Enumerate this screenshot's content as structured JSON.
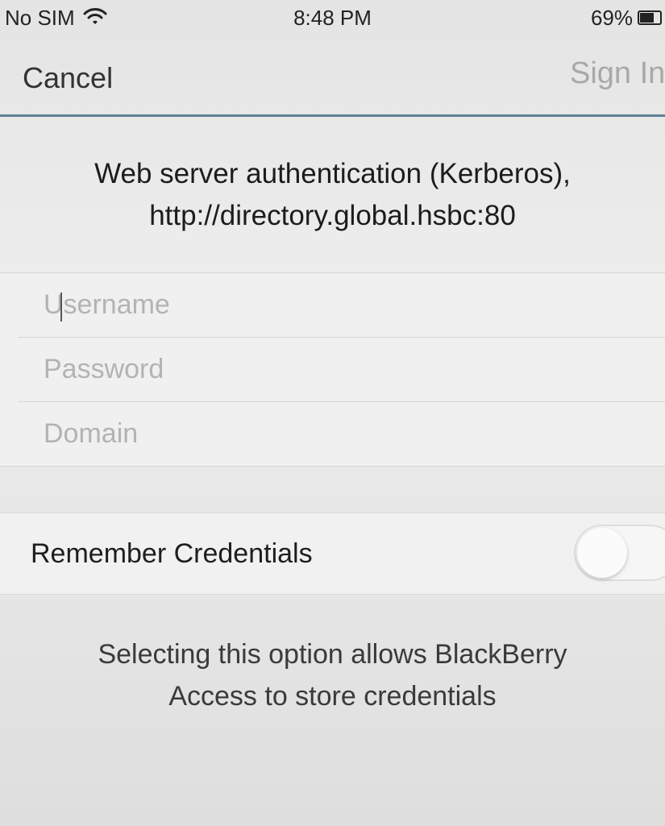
{
  "status_bar": {
    "carrier": "No SIM",
    "time": "8:48 PM",
    "battery_percent": "69%",
    "battery_level": 0.69,
    "icons": [
      "wifi-icon",
      "battery-icon"
    ]
  },
  "nav": {
    "cancel_label": "Cancel",
    "sign_in_label": "Sign In"
  },
  "header": {
    "line1": "Web server authentication (Kerberos),",
    "line2": "http://directory.global.hsbc:80"
  },
  "form": {
    "username_placeholder": "Username",
    "password_placeholder": "Password",
    "domain_placeholder": "Domain"
  },
  "remember": {
    "label": "Remember Credentials",
    "enabled": false
  },
  "note": {
    "line1": "Selecting this option allows BlackBerry",
    "line2": "Access to store credentials"
  },
  "colors": {
    "nav_underline": "#5e7f93",
    "placeholder": "#b3b3b3",
    "disabled_action": "#a8a8a8"
  }
}
